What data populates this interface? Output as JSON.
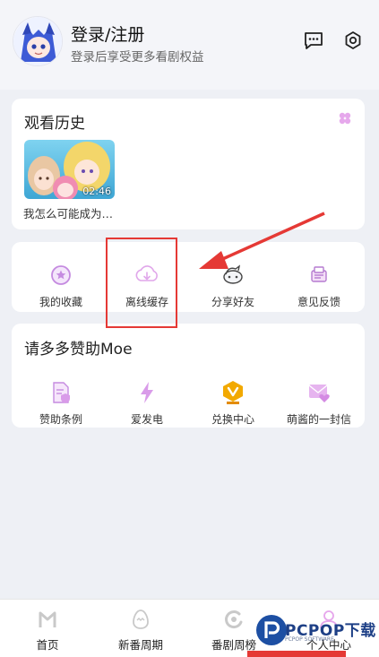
{
  "header": {
    "login_title": "登录/注册",
    "login_subtitle": "登录后享受更多看剧权益",
    "message_icon": "message-icon",
    "settings_icon": "gear-icon"
  },
  "history": {
    "title": "观看历史",
    "items": [
      {
        "caption": "我怎么可能成为…",
        "duration": "02:46"
      }
    ]
  },
  "tools": [
    {
      "label": "我的收藏",
      "icon": "favorites-icon"
    },
    {
      "label": "离线缓存",
      "icon": "cloud-download-icon"
    },
    {
      "label": "分享好友",
      "icon": "share-icon"
    },
    {
      "label": "意见反馈",
      "icon": "feedback-icon"
    }
  ],
  "sponsor": {
    "title": "请多多赞助Moe",
    "items": [
      {
        "label": "赞助条例",
        "icon": "document-shield-icon"
      },
      {
        "label": "爱发电",
        "icon": "lightning-icon"
      },
      {
        "label": "兑换中心",
        "icon": "badge-icon"
      },
      {
        "label": "萌酱的一封信",
        "icon": "letter-heart-icon"
      }
    ]
  },
  "tabbar": {
    "tabs": [
      {
        "label": "首页",
        "icon": "home-icon"
      },
      {
        "label": "新番周期",
        "icon": "egg-icon"
      },
      {
        "label": "番剧周榜",
        "icon": "ranking-icon"
      },
      {
        "label": "个人中心",
        "icon": "profile-icon"
      }
    ],
    "active_index": 3
  },
  "watermark": {
    "brand": "PCPOP下载",
    "sub": "PCPOP SOFTWARE"
  },
  "colors": {
    "accent_purple": "#c58be0",
    "annotation_red": "#e53935",
    "badge_gold": "#f2a900"
  }
}
